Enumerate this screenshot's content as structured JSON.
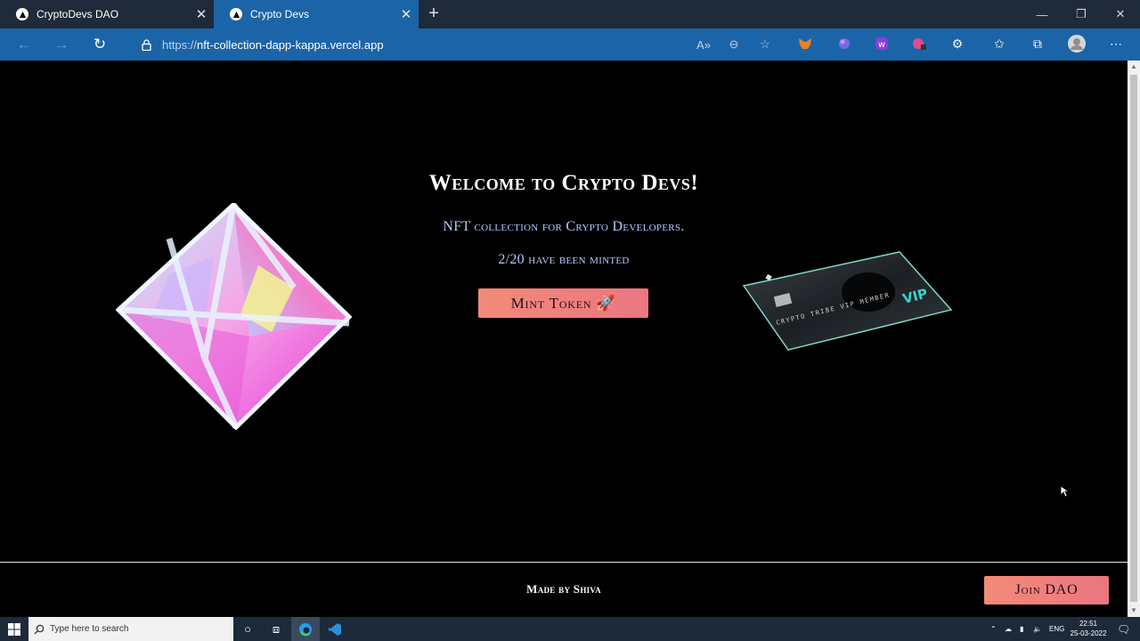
{
  "browser": {
    "tabs": [
      {
        "title": "CryptoDevs DAO",
        "active": false
      },
      {
        "title": "Crypto Devs",
        "active": true
      }
    ],
    "new_tab_label": "+",
    "address": {
      "prefix": "https://",
      "host": "nft-collection-dapp-kappa.vercel.app"
    },
    "colors": {
      "tabbar": "#1f2a3a",
      "active_tab": "#1c64a8",
      "toolbar": "#1c64a8"
    }
  },
  "page": {
    "title": "Welcome to Crypto Devs!",
    "description": "NFT collection for Crypto Developers.",
    "minted_text": "2/20 have been minted",
    "mint_button": "Mint Token 🚀",
    "footer_text": "Made by Shiva",
    "join_button": "Join DAO",
    "card_label": "VIP",
    "card_caption": "CRYPTO TRIBE VIP MEMBER",
    "colors": {
      "background": "#000000",
      "button_from": "#f38a78",
      "button_to": "#eb7680",
      "subtitle": "#b9c8ff"
    }
  },
  "taskbar": {
    "search_placeholder": "Type here to search",
    "language": "ENG",
    "time": "22:51",
    "date": "25-03-2022"
  }
}
